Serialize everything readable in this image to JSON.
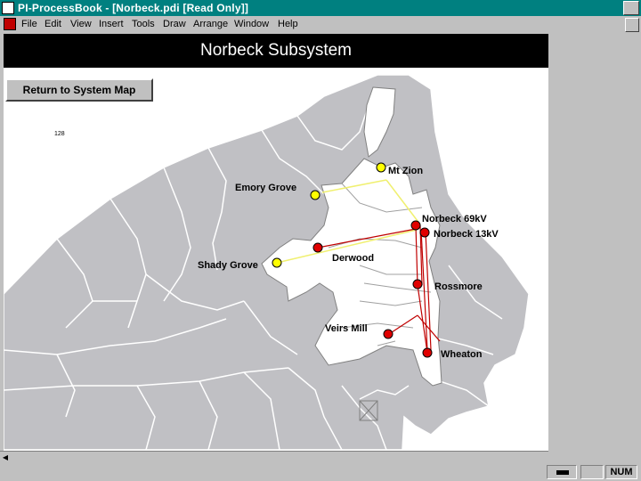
{
  "window": {
    "title": "PI-ProcessBook - [Norbeck.pdi [Read Only]]"
  },
  "menu": {
    "items": [
      "File",
      "Edit",
      "View",
      "Insert",
      "Tools",
      "Draw",
      "Arrange",
      "Window",
      "Help"
    ]
  },
  "display": {
    "title": "Norbeck Subsystem",
    "return_button": "Return to System Map",
    "small_value": "128"
  },
  "substations": [
    {
      "name": "Mt Zion",
      "status": "yellow"
    },
    {
      "name": "Emory Grove",
      "status": "yellow"
    },
    {
      "name": "Norbeck 69kV",
      "status": "red"
    },
    {
      "name": "Norbeck 13kV",
      "status": "red"
    },
    {
      "name": "Derwood",
      "status": "red"
    },
    {
      "name": "Shady Grove",
      "status": "yellow"
    },
    {
      "name": "Rossmore",
      "status": "red"
    },
    {
      "name": "Veirs Mill",
      "status": "red"
    },
    {
      "name": "Wheaton",
      "status": "red"
    }
  ],
  "colors": {
    "yellow": "#ffff00",
    "red": "#e00000",
    "region_gray": "#c0c0c4",
    "region_white": "#ffffff",
    "line_yellow": "#f0f070",
    "line_red": "#c00000"
  },
  "statusbar": {
    "mode": "NUM"
  }
}
